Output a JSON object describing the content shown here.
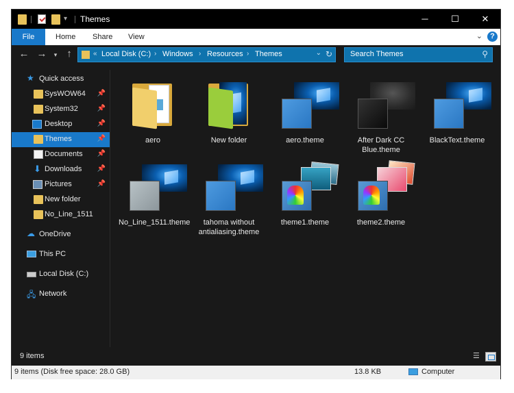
{
  "window": {
    "title": "Themes"
  },
  "ribbon": {
    "tabs": [
      "File",
      "Home",
      "Share",
      "View"
    ]
  },
  "nav": {
    "crumbs": [
      "Local Disk (C:)",
      "Windows",
      "Resources",
      "Themes"
    ],
    "search_placeholder": "Search Themes"
  },
  "sidebar": {
    "items": [
      {
        "label": "Quick access"
      },
      {
        "label": "SysWOW64"
      },
      {
        "label": "System32"
      },
      {
        "label": "Desktop"
      },
      {
        "label": "Themes"
      },
      {
        "label": "Documents"
      },
      {
        "label": "Downloads"
      },
      {
        "label": "Pictures"
      },
      {
        "label": "New folder"
      },
      {
        "label": "No_Line_1511"
      },
      {
        "label": "OneDrive"
      },
      {
        "label": "This PC"
      },
      {
        "label": "Local Disk (C:)"
      },
      {
        "label": "Network"
      }
    ]
  },
  "files": [
    {
      "name": "aero"
    },
    {
      "name": "New folder"
    },
    {
      "name": "aero.theme"
    },
    {
      "name": "After Dark CC Blue.theme"
    },
    {
      "name": "BlackText.theme"
    },
    {
      "name": "No_Line_1511.theme"
    },
    {
      "name": "tahoma without antialiasing.theme"
    },
    {
      "name": "theme1.theme"
    },
    {
      "name": "theme2.theme"
    }
  ],
  "status": {
    "item_count": "9 items",
    "detail": "9 items (Disk free space: 28.0 GB)",
    "size": "13.8 KB",
    "location": "Computer"
  },
  "colors": {
    "accent": "#1979ca",
    "background": "#191919",
    "address_bar": "#0f73ad"
  },
  "icons": [
    "folder-icon",
    "properties-icon",
    "pin-icon",
    "star-icon",
    "download-arrow-icon",
    "onedrive-cloud-icon",
    "computer-icon",
    "drive-icon",
    "network-icon",
    "search-icon",
    "refresh-icon",
    "help-icon"
  ]
}
